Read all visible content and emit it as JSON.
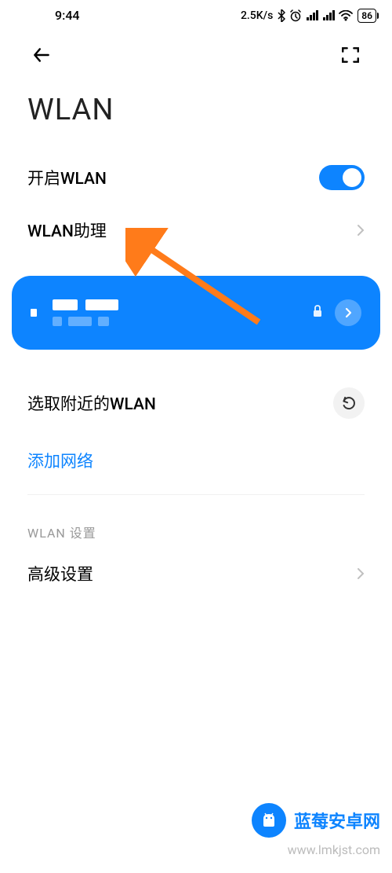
{
  "status_bar": {
    "time": "9:44",
    "speed": "2.5K/s",
    "battery": "86"
  },
  "page": {
    "title": "WLAN"
  },
  "settings": {
    "wlan_toggle_label": "开启WLAN",
    "wlan_assistant_label": "WLAN助理",
    "nearby_label": "选取附近的WLAN",
    "add_network_label": "添加网络",
    "section_header": "WLAN 设置",
    "advanced_label": "高级设置"
  },
  "watermark": {
    "name": "蓝莓安卓网",
    "url": "www.lmkjst.com"
  }
}
